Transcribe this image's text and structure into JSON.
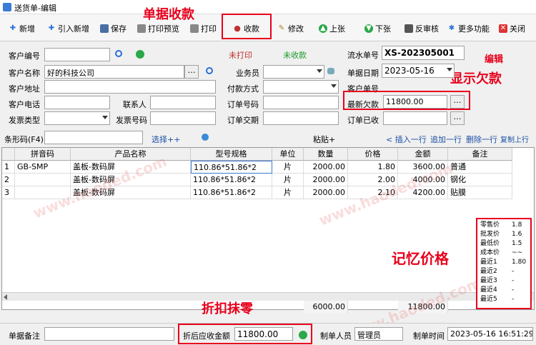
{
  "window": {
    "title": "送货单-编辑"
  },
  "toolbar": {
    "new": "新增",
    "import": "引入新增",
    "save": "保存",
    "preview": "打印预览",
    "print": "打印",
    "collect": "收款",
    "edit": "修改",
    "prev": "上张",
    "next": "下张",
    "unaudit": "反审核",
    "more": "更多功能",
    "close": "关闭"
  },
  "annotations": {
    "collect": "单据收款",
    "edit": "编辑",
    "debt": "显示欠款",
    "memory": "记忆价格",
    "discount": "折扣抹零"
  },
  "form": {
    "customer_no_label": "客户编号",
    "customer_no": "",
    "status_print": "未打印",
    "status_collect": "未收款",
    "serial_label": "流水单号",
    "serial": "XS-202305001",
    "customer_name_label": "客户名称",
    "customer_name": "好的科技公司",
    "salesman_label": "业务员",
    "salesman": "",
    "date_label": "单据日期",
    "date": "2023-05-16",
    "address_label": "客户地址",
    "address": "",
    "pay_label": "付款方式",
    "pay": "",
    "cust_order_label": "客户单号",
    "cust_order": "",
    "phone_label": "客户电话",
    "phone": "",
    "contact_label": "联系人",
    "contact": "",
    "order_no_label": "订单号码",
    "order_no": "",
    "debt_label": "最新欠款",
    "debt": "11800.00",
    "invoice_type_label": "发票类型",
    "invoice_type": "",
    "invoice_no_label": "发票号码",
    "invoice_no": "",
    "delivery_label": "订单交期",
    "delivery": "",
    "received_label": "订单已收",
    "received": ""
  },
  "barcode": {
    "label": "条形码(F4)",
    "select": "选择++",
    "paste": "粘贴+",
    "insert": "< 插入一行",
    "append": "追加一行",
    "delete": "删除一行",
    "copy": "复制上行"
  },
  "table": {
    "headers": [
      "拼音码",
      "产品名称",
      "型号规格",
      "单位",
      "数量",
      "价格",
      "金额",
      "备注"
    ],
    "rows": [
      {
        "no": "1",
        "py": "GB-SMP",
        "name": "盖板-数码屏",
        "spec": "110.86*51.86*2",
        "unit": "片",
        "qty": "2000.00",
        "price": "1.80",
        "amount": "3600.00",
        "note": "普通"
      },
      {
        "no": "2",
        "py": "",
        "name": "盖板-数码屏",
        "spec": "110.86*51.86*2",
        "unit": "片",
        "qty": "2000.00",
        "price": "2.00",
        "amount": "4000.00",
        "note": "钢化"
      },
      {
        "no": "3",
        "py": "",
        "name": "盖板-数码屏",
        "spec": "110.86*51.86*2",
        "unit": "片",
        "qty": "2000.00",
        "price": "2.10",
        "amount": "4200.00",
        "note": "贴膜"
      }
    ],
    "total_qty": "6000.00",
    "total_amount": "11800.00"
  },
  "price_memory": [
    {
      "k": "零售价",
      "v": "1.8"
    },
    {
      "k": "批发价",
      "v": "1.6"
    },
    {
      "k": "最低价",
      "v": "1.5"
    },
    {
      "k": "成本价",
      "v": "~~"
    },
    {
      "k": "最近1",
      "v": "1.80"
    },
    {
      "k": "最近2",
      "v": "-"
    },
    {
      "k": "最近3",
      "v": "-"
    },
    {
      "k": "最近4",
      "v": "-"
    },
    {
      "k": "最近5",
      "v": "-"
    }
  ],
  "footer": {
    "remark_label": "单据备注",
    "remark": "",
    "receivable_label": "折后应收金额",
    "receivable": "11800.00",
    "maker_label": "制单人员",
    "maker": "管理员",
    "time_label": "制单时间",
    "time": "2023-05-16 16:51:29"
  },
  "watermark": "www.haoded.com"
}
